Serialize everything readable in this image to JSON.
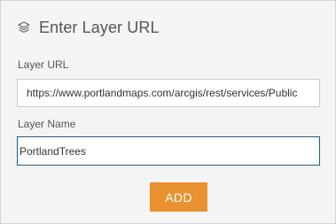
{
  "header": {
    "icon": "layers-icon",
    "title": "Enter Layer URL"
  },
  "form": {
    "url_label": "Layer URL",
    "url_value": "https://www.portlandmaps.com/arcgis/rest/services/Public",
    "name_label": "Layer Name",
    "name_value": "PortlandTrees"
  },
  "actions": {
    "add_label": "ADD"
  },
  "colors": {
    "panel_background": "#f4f4f4",
    "accent_button": "#e8912e",
    "focus_border": "#1f5a8a"
  }
}
